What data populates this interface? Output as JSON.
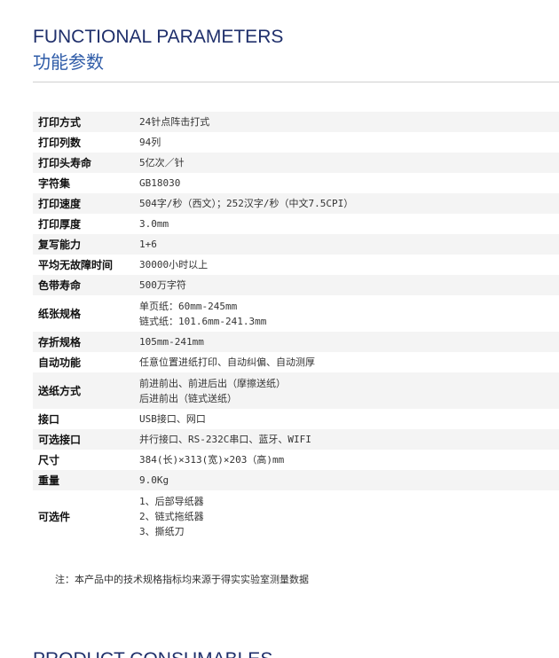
{
  "header": {
    "title_en": "FUNCTIONAL PARAMETERS",
    "title_cn": "功能参数"
  },
  "specs": [
    {
      "label": "打印方式",
      "lines": [
        "24针点阵击打式"
      ]
    },
    {
      "label": "打印列数",
      "lines": [
        "94列"
      ]
    },
    {
      "label": "打印头寿命",
      "lines": [
        "5亿次／针"
      ]
    },
    {
      "label": "字符集",
      "lines": [
        "GB18030"
      ]
    },
    {
      "label": "打印速度",
      "lines": [
        "504字/秒（西文）；252汉字/秒（中文7.5CPI）"
      ]
    },
    {
      "label": "打印厚度",
      "lines": [
        "3.0mm"
      ]
    },
    {
      "label": "复写能力",
      "lines": [
        "1+6"
      ]
    },
    {
      "label": "平均无故障时间",
      "lines": [
        "30000小时以上"
      ]
    },
    {
      "label": "色带寿命",
      "lines": [
        "500万字符"
      ]
    },
    {
      "label": "纸张规格",
      "lines": [
        "单页纸：60mm-245mm",
        "链式纸：101.6mm-241.3mm"
      ]
    },
    {
      "label": "存折规格",
      "lines": [
        "105mm-241mm"
      ]
    },
    {
      "label": "自动功能",
      "lines": [
        "任意位置进纸打印、自动纠偏、自动测厚"
      ]
    },
    {
      "label": "送纸方式",
      "lines": [
        "前进前出、前进后出（摩擦送纸）",
        "后进前出（链式送纸）"
      ]
    },
    {
      "label": "接口",
      "lines": [
        "USB接口、网口"
      ]
    },
    {
      "label": "可选接口",
      "lines": [
        "并行接口、RS-232C串口、蓝牙、WIFI"
      ]
    },
    {
      "label": "尺寸",
      "lines": [
        "384(长)×313(宽)×203（高)mm"
      ]
    },
    {
      "label": "重量",
      "lines": [
        "9.0Kg"
      ]
    },
    {
      "label": "可选件",
      "lines": [
        "1、后部导纸器",
        "2、链式拖纸器",
        "3、撕纸刀"
      ]
    }
  ],
  "note": "注：本产品中的技术规格指标均来源于得实实验室测量数据",
  "next_section_title": "PRODUCT CONSUMABLES"
}
